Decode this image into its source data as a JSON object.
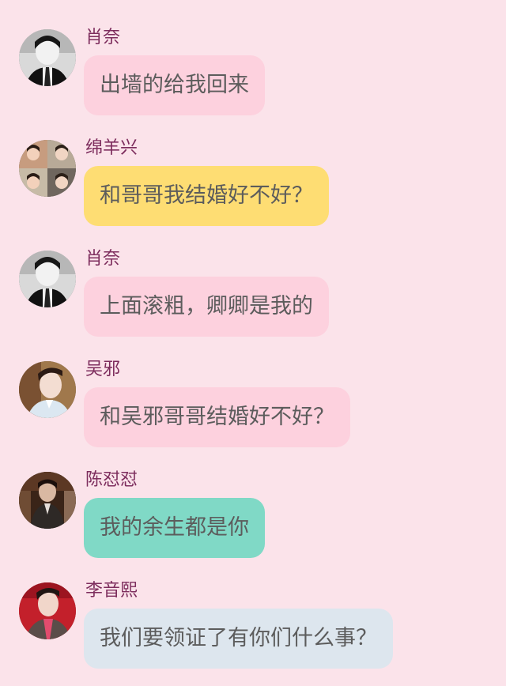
{
  "messages": [
    {
      "avatar": "avatar-man-black-white",
      "name": "肖奈",
      "text": "出墙的给我回来",
      "bubble_color": "#fdd1de"
    },
    {
      "avatar": "avatar-man-collage",
      "name": "绵羊兴",
      "text": "和哥哥我结婚好不好？",
      "bubble_color": "#fedd73"
    },
    {
      "avatar": "avatar-man-black-white",
      "name": "肖奈",
      "text": "上面滚粗，卿卿是我的",
      "bubble_color": "#fdd1de"
    },
    {
      "avatar": "avatar-man-light-shirt",
      "name": "吴邪",
      "text": "和吴邪哥哥结婚好不好？",
      "bubble_color": "#fdd1de"
    },
    {
      "avatar": "avatar-man-uniform",
      "name": "陈怼怼",
      "text": "我的余生都是你",
      "bubble_color": "#80d9c6"
    },
    {
      "avatar": "avatar-man-red-background",
      "name": "李音熙",
      "text": "我们要领证了有你们什么事？",
      "bubble_color": "#dde6ee"
    }
  ]
}
